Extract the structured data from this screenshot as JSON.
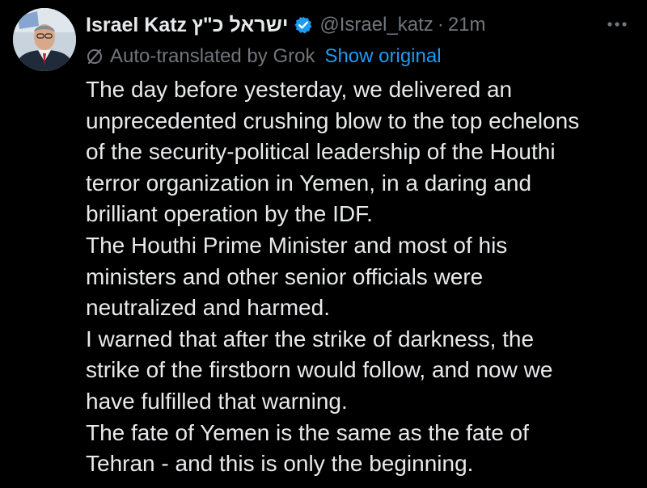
{
  "post": {
    "author": {
      "display_name": "Israel Katz",
      "hebrew_name": "ישראל כ\"ץ",
      "handle": "@Israel_katz",
      "separator": "·",
      "time": "21m"
    },
    "translation": {
      "label": "Auto-translated by Grok",
      "show_original": "Show original"
    },
    "lines": [
      "The day before yesterday, we delivered an",
      "unprecedented crushing blow to the top echelons",
      "of the security-political leadership of the Houthi",
      "terror organization in Yemen, in a daring and",
      "brilliant operation by the IDF.",
      "The Houthi Prime Minister and most of his",
      "ministers and other senior officials were",
      "neutralized and harmed.",
      "I warned that after the strike of darkness, the",
      "strike of the firstborn would follow, and now we",
      "have fulfilled that warning.",
      "The fate of Yemen is the same as the fate of",
      "Tehran - and this is only the beginning."
    ]
  },
  "icons": {
    "avatar": "profile-photo",
    "verified": "verified-badge-icon",
    "more": "more-options-icon",
    "translate": "grok-slash-icon"
  },
  "colors": {
    "background": "#000000",
    "text_primary": "#e7e9ea",
    "text_secondary": "#71767b",
    "link": "#1d9bf0",
    "verified_badge": "#1d9bf0"
  }
}
